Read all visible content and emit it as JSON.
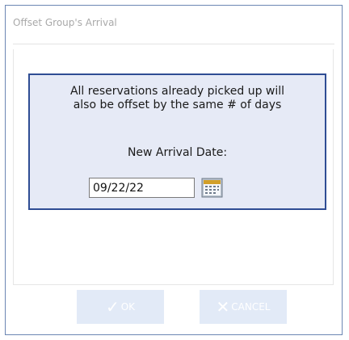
{
  "dialog": {
    "title": "Offset Group's Arrival"
  },
  "panel": {
    "message_line1": "All reservations already picked up will",
    "message_line2": "also be offset by the same # of days",
    "arrival_label": "New Arrival Date:",
    "arrival_date": "09/22/22",
    "calendar_icon": "calendar-icon"
  },
  "buttons": {
    "ok_label": "OK",
    "ok_icon": "checkmark-icon",
    "cancel_label": "CANCEL",
    "cancel_icon": "x-icon",
    "state": "disabled"
  },
  "colors": {
    "panel_border": "#2f4d94",
    "panel_background": "#e6eaf6",
    "button_background": "#e2eaf7",
    "window_border": "#6b86b3"
  }
}
